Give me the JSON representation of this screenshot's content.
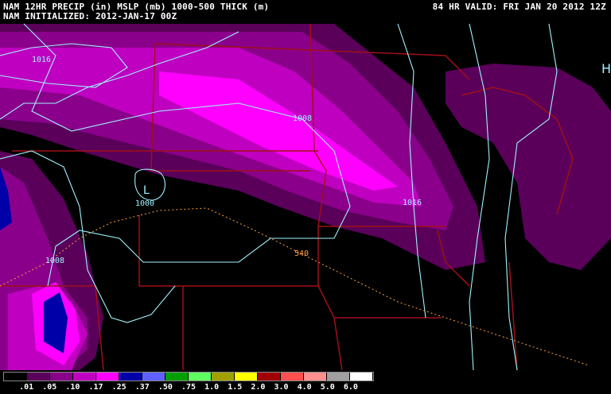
{
  "header": {
    "line1_left": "NAM 12HR PRECIP (in) MSLP (mb) 1000-500 THICK (m)",
    "line2_left": "NAM INITIALIZED: 2012-JAN-17 00Z",
    "line1_right": "84 HR VALID: FRI JAN 20 2012 12Z"
  },
  "map": {
    "isobar_labels": [
      "1016",
      "1008",
      "1000",
      "1008",
      "1016"
    ],
    "low_label": "L",
    "high_label": "H",
    "thickness_label": "540",
    "colors": {
      "isobar": "#9ff3ff",
      "thickness": "#ffa040",
      "borders": "#a01018"
    }
  },
  "legend": {
    "labels": [
      ".01",
      ".05",
      ".10",
      ".17",
      ".25",
      ".37",
      ".50",
      ".75",
      "1.0",
      "1.5",
      "2.0",
      "3.0",
      "4.0",
      "5.0",
      "6.0"
    ],
    "colors": [
      "#000000",
      "#5a005a",
      "#8a008a",
      "#c000c0",
      "#ff00ff",
      "#0000a8",
      "#6060ff",
      "#00a000",
      "#60ff60",
      "#a0a000",
      "#ffff00",
      "#a00000",
      "#ff5050",
      "#ff9090",
      "#a0a0a0",
      "#ffffff"
    ]
  }
}
